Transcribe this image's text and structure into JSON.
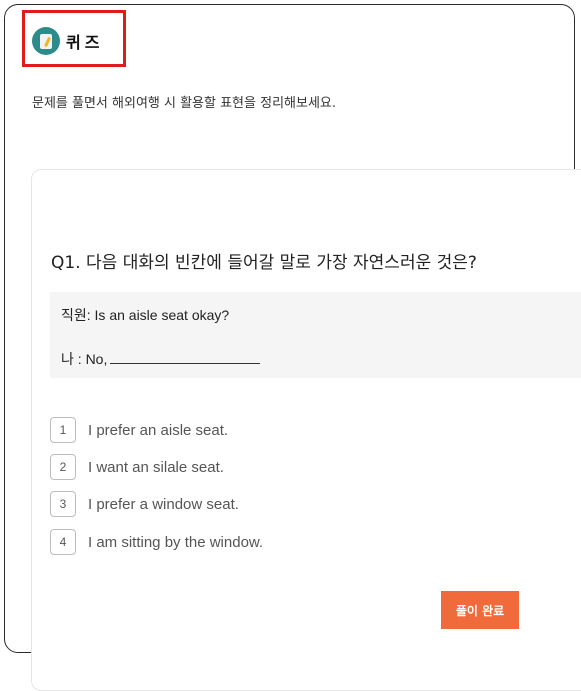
{
  "header": {
    "logo_icon": "quiz-document-icon",
    "title": "퀴즈",
    "highlight_color": "#e01b1b"
  },
  "subtitle": "문제를 풀면서 해외여행 시 활용할 표현을 정리해보세요.",
  "quiz": {
    "question": "Q1. 다음 대화의 빈칸에 들어갈 말로 가장 자연스러운 것은?",
    "dialog": {
      "line1_speaker": "직원:",
      "line1_text": "Is an aisle seat okay?",
      "line2_speaker": "나 :",
      "line2_text": "No,"
    },
    "options": [
      {
        "number": "1",
        "text": "I prefer an aisle seat."
      },
      {
        "number": "2",
        "text": "I want an silale seat."
      },
      {
        "number": "3",
        "text": "I prefer a window seat."
      },
      {
        "number": "4",
        "text": "I am sitting by the window."
      }
    ],
    "submit_label": "풀이 완료",
    "accent_color": "#f16a3b"
  }
}
